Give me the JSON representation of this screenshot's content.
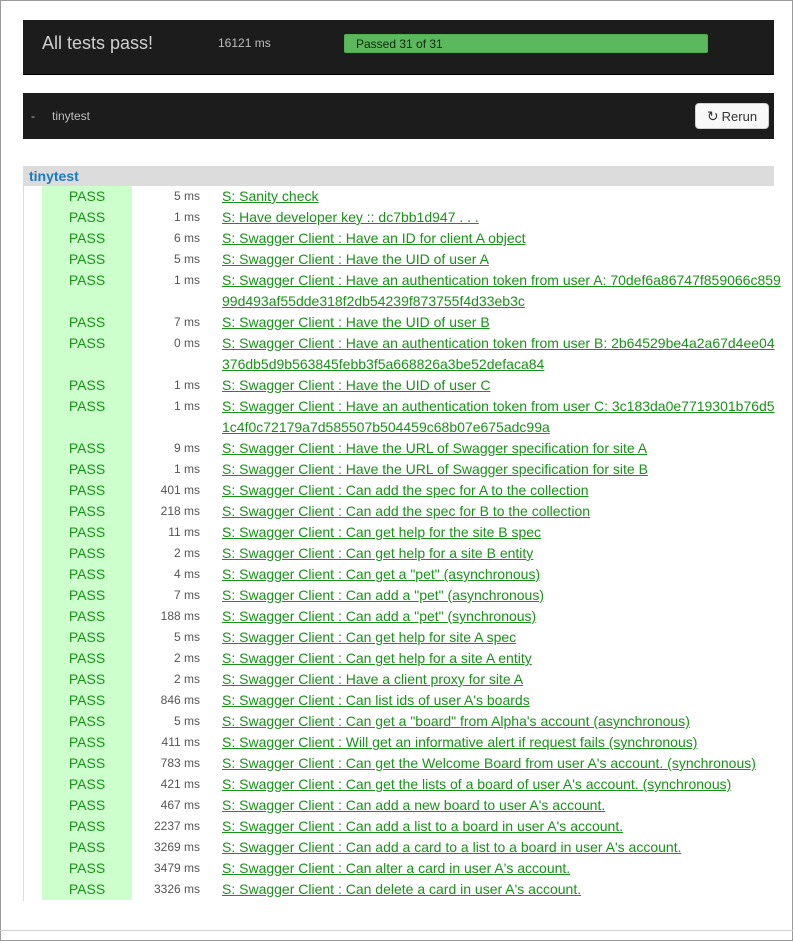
{
  "summary": {
    "title": "All tests pass!",
    "duration": "16121 ms",
    "progress_text": "Passed 31 of 31",
    "progress_fraction": 1.0,
    "colors": {
      "bar": "#5cb85c",
      "pass_bg": "#ccffcc",
      "pass_text": "#199219",
      "suite_link": "#1a7abf"
    }
  },
  "toolbar": {
    "dash": "-",
    "breadcrumb": "tinytest",
    "rerun_label": "Rerun",
    "rerun_icon": "refresh-icon"
  },
  "suite": {
    "name": "tinytest",
    "tests": [
      {
        "status": "PASS",
        "time": "5 ms",
        "name": "S: Sanity check"
      },
      {
        "status": "PASS",
        "time": "1 ms",
        "name": "S: Have developer key :: dc7bb1d947 . . ."
      },
      {
        "status": "PASS",
        "time": "6 ms",
        "name": "S: Swagger Client : Have an ID for client A object"
      },
      {
        "status": "PASS",
        "time": "5 ms",
        "name": "S: Swagger Client : Have the UID of user A"
      },
      {
        "status": "PASS",
        "time": "1 ms",
        "name": "S: Swagger Client : Have an authentication token from user A: 70def6a86747f859066c85999d493af55dde318f2db54239f873755f4d33eb3c"
      },
      {
        "status": "PASS",
        "time": "7 ms",
        "name": "S: Swagger Client : Have the UID of user B"
      },
      {
        "status": "PASS",
        "time": "0 ms",
        "name": "S: Swagger Client : Have an authentication token from user B: 2b64529be4a2a67d4ee04376db5d9b563845febb3f5a668826a3be52defaca84"
      },
      {
        "status": "PASS",
        "time": "1 ms",
        "name": "S: Swagger Client : Have the UID of user C"
      },
      {
        "status": "PASS",
        "time": "1 ms",
        "name": "S: Swagger Client : Have an authentication token from user C: 3c183da0e7719301b76d51c4f0c72179a7d585507b504459c68b07e675adc99a"
      },
      {
        "status": "PASS",
        "time": "9 ms",
        "name": "S: Swagger Client : Have the URL of Swagger specification for site A"
      },
      {
        "status": "PASS",
        "time": "1 ms",
        "name": "S: Swagger Client : Have the URL of Swagger specification for site B"
      },
      {
        "status": "PASS",
        "time": "401 ms",
        "name": "S: Swagger Client : Can add the spec for A to the collection"
      },
      {
        "status": "PASS",
        "time": "218 ms",
        "name": "S: Swagger Client : Can add the spec for B to the collection"
      },
      {
        "status": "PASS",
        "time": "11 ms",
        "name": "S: Swagger Client : Can get help for the site B spec"
      },
      {
        "status": "PASS",
        "time": "2 ms",
        "name": "S: Swagger Client : Can get help for a site B entity"
      },
      {
        "status": "PASS",
        "time": "4 ms",
        "name": "S: Swagger Client : Can get a \"pet\" (asynchronous)"
      },
      {
        "status": "PASS",
        "time": "7 ms",
        "name": "S: Swagger Client : Can add a \"pet\" (asynchronous)"
      },
      {
        "status": "PASS",
        "time": "188 ms",
        "name": "S: Swagger Client : Can add a \"pet\" (synchronous)"
      },
      {
        "status": "PASS",
        "time": "5 ms",
        "name": "S: Swagger Client : Can get help for site A spec"
      },
      {
        "status": "PASS",
        "time": "2 ms",
        "name": "S: Swagger Client : Can get help for a site A entity"
      },
      {
        "status": "PASS",
        "time": "2 ms",
        "name": "S: Swagger Client : Have a client proxy for site A"
      },
      {
        "status": "PASS",
        "time": "846 ms",
        "name": "S: Swagger Client : Can list ids of user A's boards"
      },
      {
        "status": "PASS",
        "time": "5 ms",
        "name": "S: Swagger Client : Can get a \"board\" from Alpha's account (asynchronous)"
      },
      {
        "status": "PASS",
        "time": "411 ms",
        "name": "S: Swagger Client : Will get an informative alert if request fails (synchronous)"
      },
      {
        "status": "PASS",
        "time": "783 ms",
        "name": "S: Swagger Client : Can get the Welcome Board from user A's account. (synchronous)"
      },
      {
        "status": "PASS",
        "time": "421 ms",
        "name": "S: Swagger Client : Can get the lists of a board of user A's account. (synchronous)"
      },
      {
        "status": "PASS",
        "time": "467 ms",
        "name": "S: Swagger Client : Can add a new board to user A's account."
      },
      {
        "status": "PASS",
        "time": "2237 ms",
        "name": "S: Swagger Client : Can add a list to a board in user A's account."
      },
      {
        "status": "PASS",
        "time": "3269 ms",
        "name": "S: Swagger Client : Can add a card to a list to a board in user A's account."
      },
      {
        "status": "PASS",
        "time": "3479 ms",
        "name": "S: Swagger Client : Can alter a card in user A's account."
      },
      {
        "status": "PASS",
        "time": "3326 ms",
        "name": "S: Swagger Client : Can delete a card in user A's account."
      }
    ]
  }
}
